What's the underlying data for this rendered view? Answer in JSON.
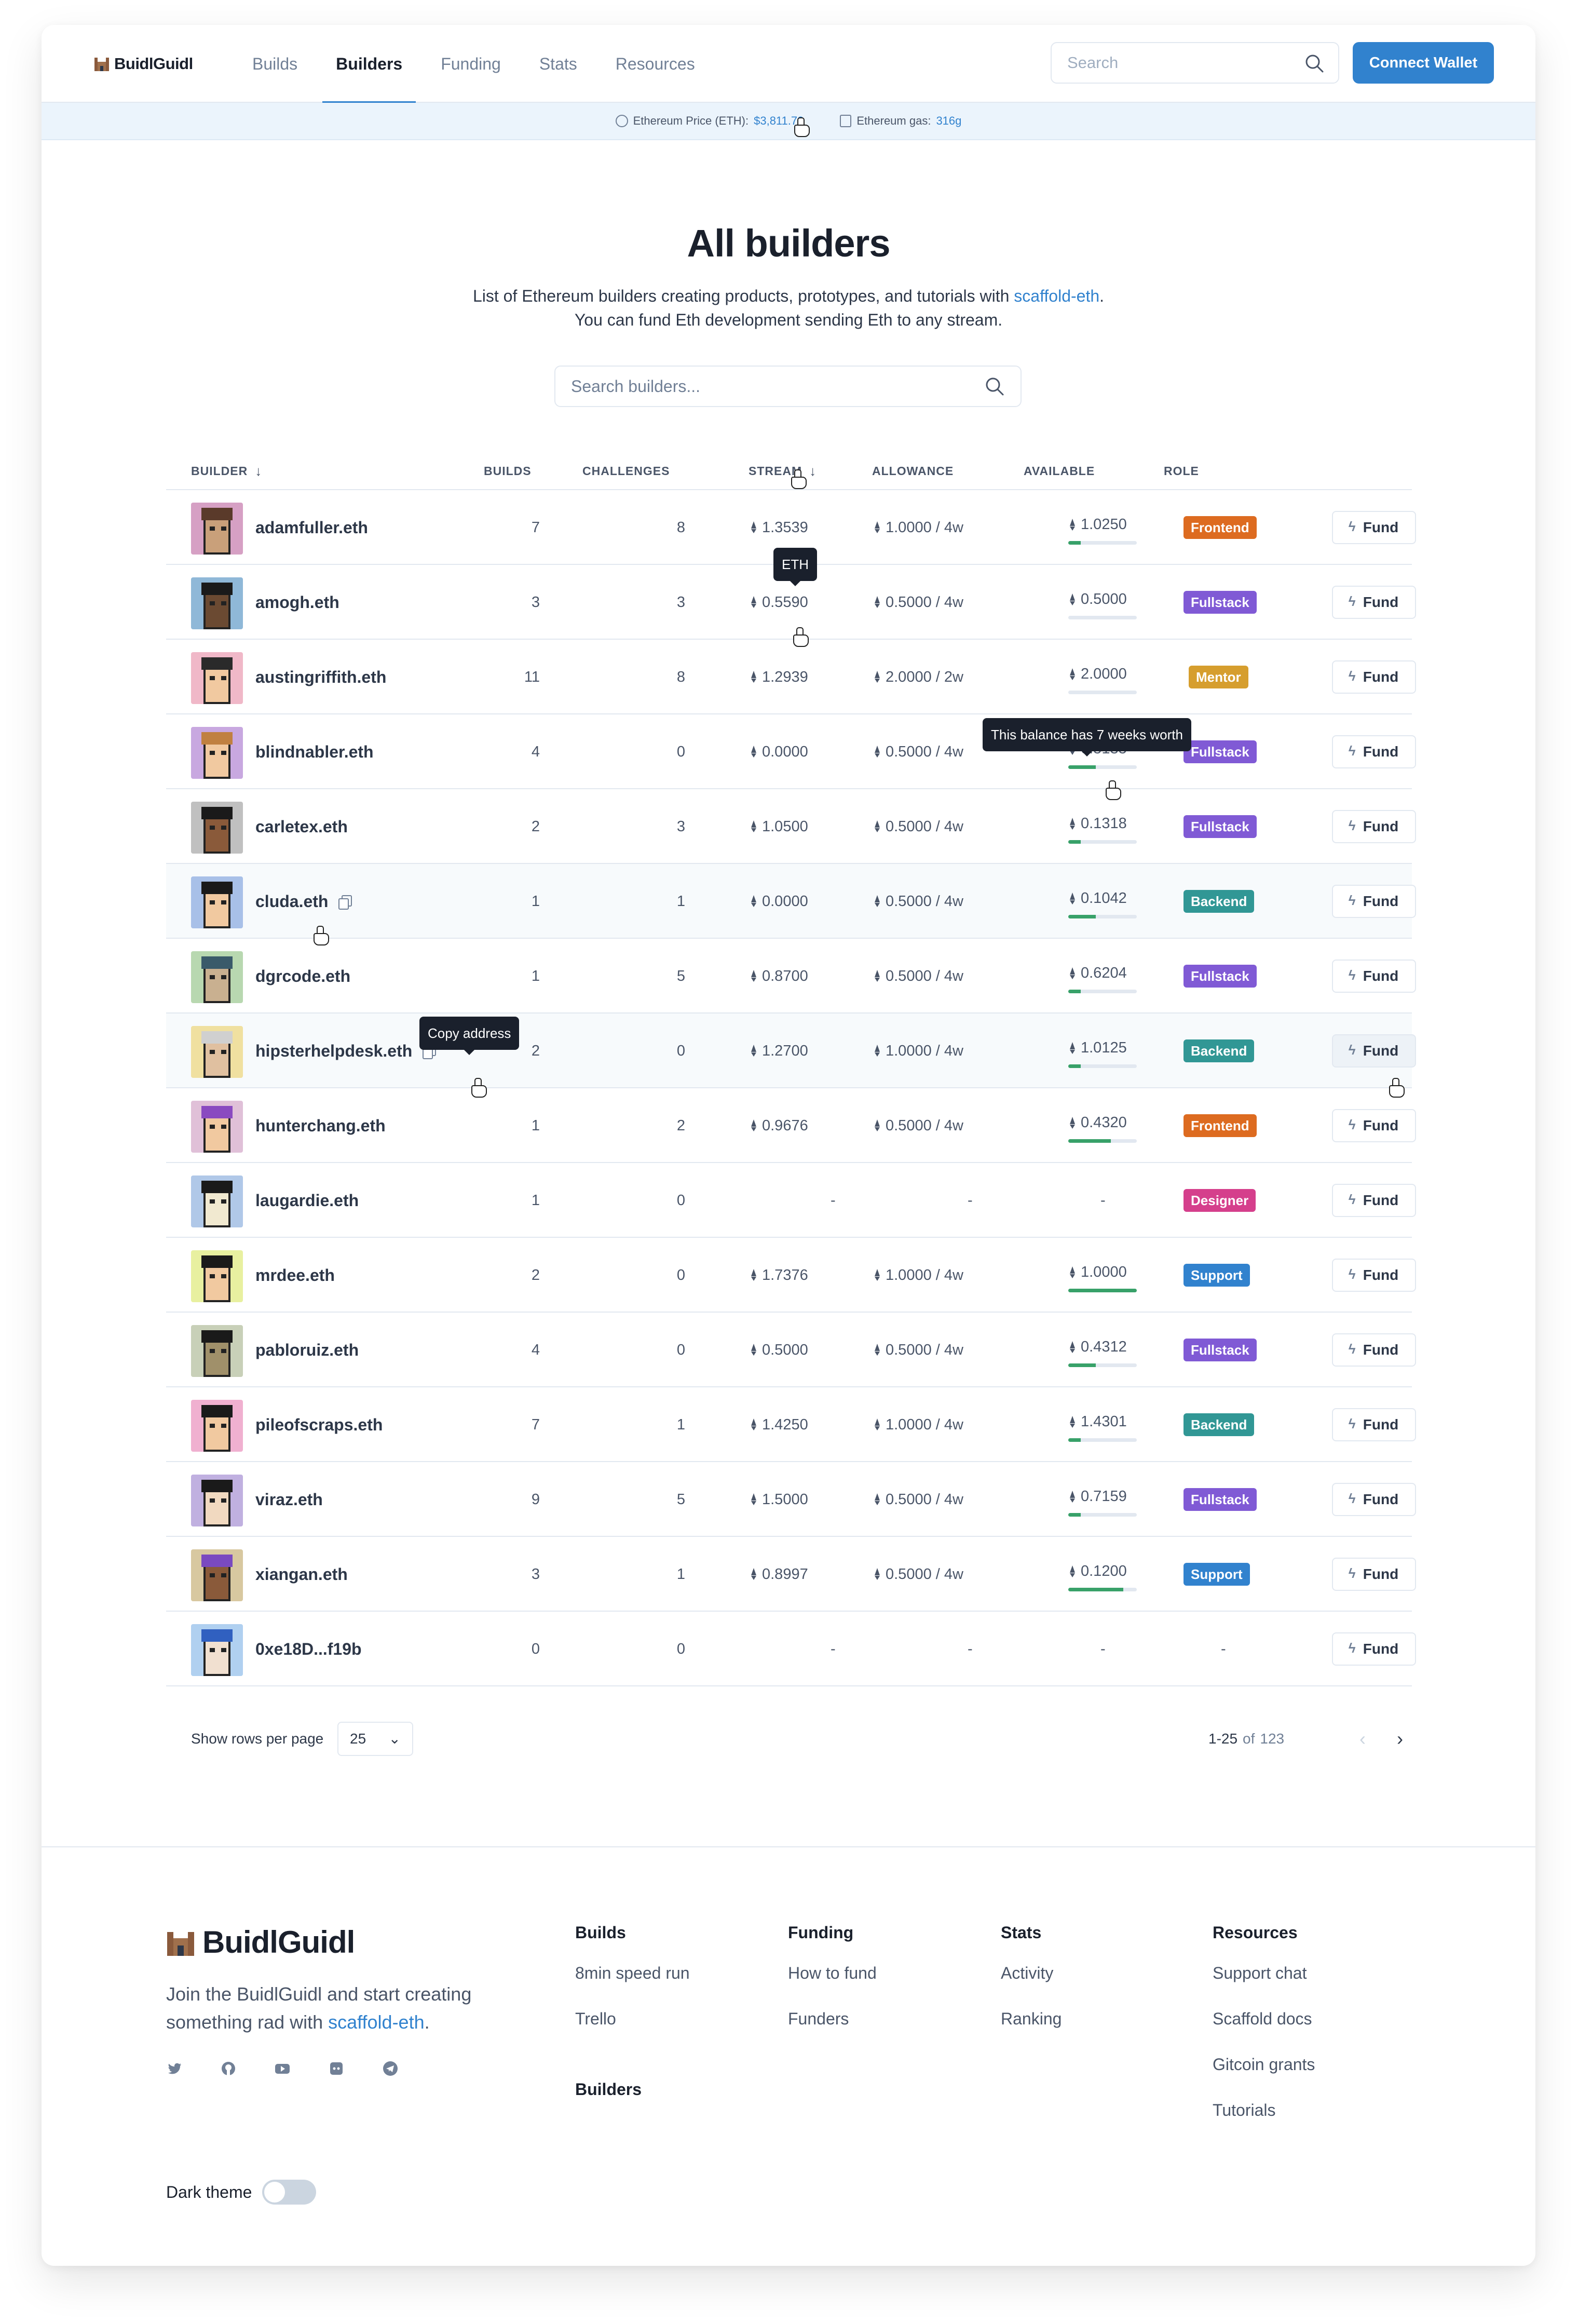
{
  "header": {
    "logo": "BuidlGuidl",
    "nav": [
      "Builds",
      "Builders",
      "Funding",
      "Stats",
      "Resources"
    ],
    "active_nav": "Builders",
    "search_placeholder": "Search",
    "connect_label": "Connect Wallet"
  },
  "pricebar": {
    "eth_label": "Ethereum Price (ETH):",
    "eth_value": "$3,811.72",
    "gas_label": "Ethereum gas:",
    "gas_value": "316g"
  },
  "hero": {
    "title": "All builders",
    "line1_text": "List of Ethereum builders creating products, prototypes, and tutorials with ",
    "line1_link": "scaffold-eth",
    "line1_end": ".",
    "line2": "You can fund Eth development sending Eth to any stream.",
    "search_placeholder": "Search builders..."
  },
  "table": {
    "headers": {
      "builder": "BUILDER",
      "builds": "BUILDS",
      "challenges": "CHALLENGES",
      "stream": "STREAM",
      "allowance": "ALLOWANCE",
      "available": "AVAILABLE",
      "role": "ROLE"
    },
    "fund_label": "Fund",
    "rows": [
      {
        "name": "adamfuller.eth",
        "builds": "7",
        "challenges": "8",
        "stream": "1.3539",
        "allowance": "1.0000 / 4w",
        "available": "1.0250",
        "avail_pct": 0.18,
        "role": "Frontend"
      },
      {
        "name": "amogh.eth",
        "builds": "3",
        "challenges": "3",
        "stream": "0.5590",
        "allowance": "0.5000 / 4w",
        "available": "0.5000",
        "avail_pct": 0.0,
        "role": "Fullstack"
      },
      {
        "name": "austingriffith.eth",
        "builds": "11",
        "challenges": "8",
        "stream": "1.2939",
        "allowance": "2.0000 / 2w",
        "available": "2.0000",
        "avail_pct": 0.0,
        "role": "Mentor"
      },
      {
        "name": "blindnabler.eth",
        "builds": "4",
        "challenges": "0",
        "stream": "0.0000",
        "allowance": "0.5000 / 4w",
        "available": "0.5135",
        "avail_pct": 0.4,
        "role": "Fullstack"
      },
      {
        "name": "carletex.eth",
        "builds": "2",
        "challenges": "3",
        "stream": "1.0500",
        "allowance": "0.5000 / 4w",
        "available": "0.1318",
        "avail_pct": 0.18,
        "role": "Fullstack"
      },
      {
        "name": "cluda.eth",
        "builds": "1",
        "challenges": "1",
        "stream": "0.0000",
        "allowance": "0.5000 / 4w",
        "available": "0.1042",
        "avail_pct": 0.4,
        "role": "Backend"
      },
      {
        "name": "dgrcode.eth",
        "builds": "1",
        "challenges": "5",
        "stream": "0.8700",
        "allowance": "0.5000 / 4w",
        "available": "0.6204",
        "avail_pct": 0.18,
        "role": "Fullstack"
      },
      {
        "name": "hipsterhelpdesk.eth",
        "builds": "2",
        "challenges": "0",
        "stream": "1.2700",
        "allowance": "1.0000 / 4w",
        "available": "1.0125",
        "avail_pct": 0.18,
        "role": "Backend"
      },
      {
        "name": "hunterchang.eth",
        "builds": "1",
        "challenges": "2",
        "stream": "0.9676",
        "allowance": "0.5000 / 4w",
        "available": "0.4320",
        "avail_pct": 0.62,
        "role": "Frontend"
      },
      {
        "name": "laugardie.eth",
        "builds": "1",
        "challenges": "0",
        "stream": "-",
        "allowance": "-",
        "available": "-",
        "avail_pct": null,
        "role": "Designer"
      },
      {
        "name": "mrdee.eth",
        "builds": "2",
        "challenges": "0",
        "stream": "1.7376",
        "allowance": "1.0000 / 4w",
        "available": "1.0000",
        "avail_pct": 1.0,
        "role": "Support"
      },
      {
        "name": "pabloruiz.eth",
        "builds": "4",
        "challenges": "0",
        "stream": "0.5000",
        "allowance": "0.5000 / 4w",
        "available": "0.4312",
        "avail_pct": 0.4,
        "role": "Fullstack"
      },
      {
        "name": "pileofscraps.eth",
        "builds": "7",
        "challenges": "1",
        "stream": "1.4250",
        "allowance": "1.0000 / 4w",
        "available": "1.4301",
        "avail_pct": 0.18,
        "role": "Backend"
      },
      {
        "name": "viraz.eth",
        "builds": "9",
        "challenges": "5",
        "stream": "1.5000",
        "allowance": "0.5000 / 4w",
        "available": "0.7159",
        "avail_pct": 0.18,
        "role": "Fullstack"
      },
      {
        "name": "xiangan.eth",
        "builds": "3",
        "challenges": "1",
        "stream": "0.8997",
        "allowance": "0.5000 / 4w",
        "available": "0.1200",
        "avail_pct": 0.8,
        "role": "Support"
      },
      {
        "name": "0xe18D...f19b",
        "builds": "0",
        "challenges": "0",
        "stream": "-",
        "allowance": "-",
        "available": "-",
        "avail_pct": null,
        "role": "-"
      }
    ]
  },
  "role_colors": {
    "Frontend": "#dd6b20",
    "Fullstack": "#805ad5",
    "Mentor": "#d69e2e",
    "Backend": "#319795",
    "Designer": "#d53f8c",
    "Support": "#3182ce"
  },
  "tooltips": {
    "eth": "ETH",
    "balance": "This balance has 7 weeks worth",
    "copy": "Copy address"
  },
  "pagination": {
    "rows_label": "Show rows per page",
    "rows_value": "25",
    "range_start": "1-25",
    "range_of": "of",
    "range_total": "123"
  },
  "footer": {
    "logo": "BuidlGuidl",
    "tagline_text": "Join the BuidlGuidl and start creating something rad with ",
    "tagline_link": "scaffold-eth",
    "tagline_end": ".",
    "socials": [
      "twitter-icon",
      "github-icon",
      "youtube-icon",
      "discord-icon",
      "telegram-icon"
    ],
    "columns": [
      {
        "head": "Builds",
        "links": [
          "8min speed run",
          "Trello"
        ],
        "extra_head": "Builders"
      },
      {
        "head": "Funding",
        "links": [
          "How to fund",
          "Funders"
        ]
      },
      {
        "head": "Stats",
        "links": [
          "Activity",
          "Ranking"
        ]
      },
      {
        "head": "Resources",
        "links": [
          "Support chat",
          "Scaffold docs",
          "Gitcoin grants",
          "Tutorials"
        ]
      }
    ],
    "dark_theme_label": "Dark theme"
  }
}
